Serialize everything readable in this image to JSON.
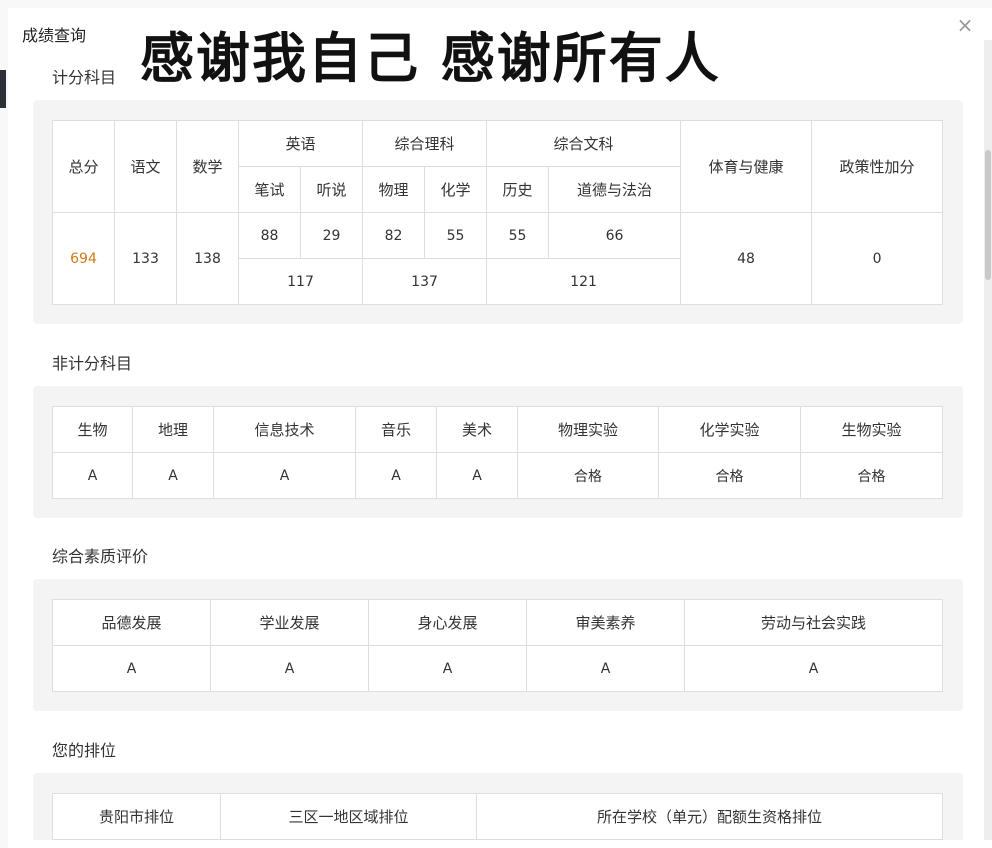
{
  "modal": {
    "title": "成绩查询",
    "overlay_caption": "感谢我自己 感谢所有人",
    "close_glyph": "×"
  },
  "scored": {
    "title": "计分科目",
    "headers": {
      "total": "总分",
      "chinese": "语文",
      "math": "数学",
      "english": "英语",
      "english_written": "笔试",
      "english_oral": "听说",
      "science": "综合理科",
      "physics": "物理",
      "chemistry": "化学",
      "liberal": "综合文科",
      "history": "历史",
      "morality": "道德与法治",
      "pe": "体育与健康",
      "bonus": "政策性加分"
    },
    "values": {
      "total": "694",
      "chinese": "133",
      "math": "138",
      "english_written": "88",
      "english_oral": "29",
      "physics": "82",
      "chemistry": "55",
      "history": "55",
      "morality": "66",
      "english_sum": "117",
      "science_sum": "137",
      "liberal_sum": "121",
      "pe": "48",
      "bonus": "0"
    },
    "total_color": "#d07a16"
  },
  "nonscored": {
    "title": "非计分科目",
    "headers": [
      "生物",
      "地理",
      "信息技术",
      "音乐",
      "美术",
      "物理实验",
      "化学实验",
      "生物实验"
    ],
    "values": [
      "A",
      "A",
      "A",
      "A",
      "A",
      "合格",
      "合格",
      "合格"
    ]
  },
  "quality": {
    "title": "综合素质评价",
    "headers": [
      "品德发展",
      "学业发展",
      "身心发展",
      "审美素养",
      "劳动与社会实践"
    ],
    "values": [
      "A",
      "A",
      "A",
      "A",
      "A"
    ]
  },
  "ranking": {
    "title": "您的排位",
    "headers": [
      "贵阳市排位",
      "三区一地区域排位",
      "所在学校（单元）配额生资格排位"
    ]
  }
}
